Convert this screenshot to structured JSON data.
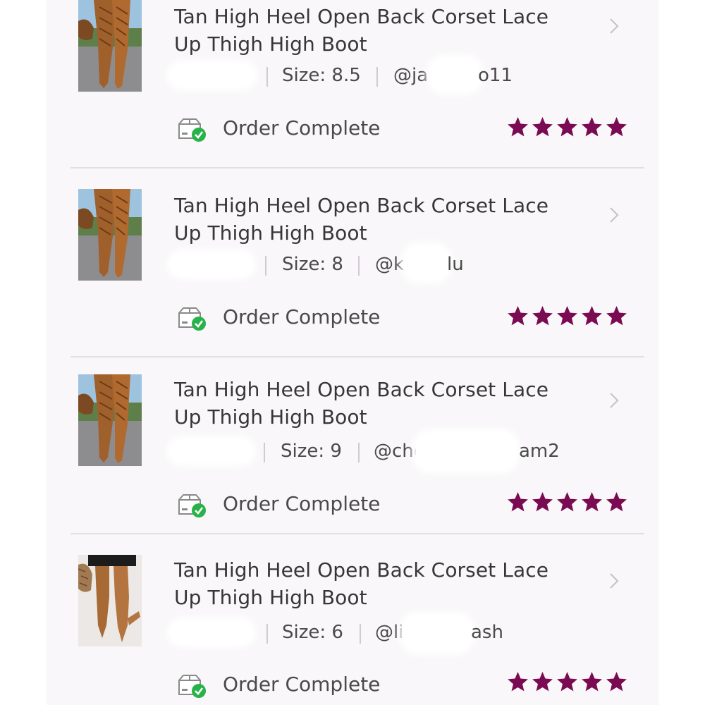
{
  "theme": {
    "star_color": "#7a0a52",
    "check_color": "#27b34a"
  },
  "orders": [
    {
      "title_line1": "Tan High Heel Open Back Corset Lace",
      "title_line2": "Up Thigh High Boot",
      "size": "Size: 8.5",
      "user_prefix": "@ja",
      "user_suffix": "o11",
      "status": "Order Complete",
      "rating": 5,
      "thumb": "boot-photo-lace-up"
    },
    {
      "title_line1": "Tan High Heel Open Back Corset Lace",
      "title_line2": "Up Thigh High Boot",
      "size": "Size: 8",
      "user_prefix": "@k",
      "user_suffix": "lu",
      "status": "Order Complete",
      "rating": 5,
      "thumb": "boot-photo-lace-up"
    },
    {
      "title_line1": "Tan High Heel Open Back Corset Lace",
      "title_line2": "Up Thigh High Boot",
      "size": "Size: 9",
      "user_prefix": "@chc",
      "user_suffix": "am2",
      "status": "Order Complete",
      "rating": 5,
      "thumb": "boot-photo-lace-up"
    },
    {
      "title_line1": "Tan High Heel Open Back Corset Lace",
      "title_line2": "Up Thigh High Boot",
      "size": "Size: 6",
      "user_prefix": "@li",
      "user_suffix": "ash",
      "status": "Order Complete",
      "rating": 5,
      "thumb": "boot-photo-worn"
    }
  ]
}
